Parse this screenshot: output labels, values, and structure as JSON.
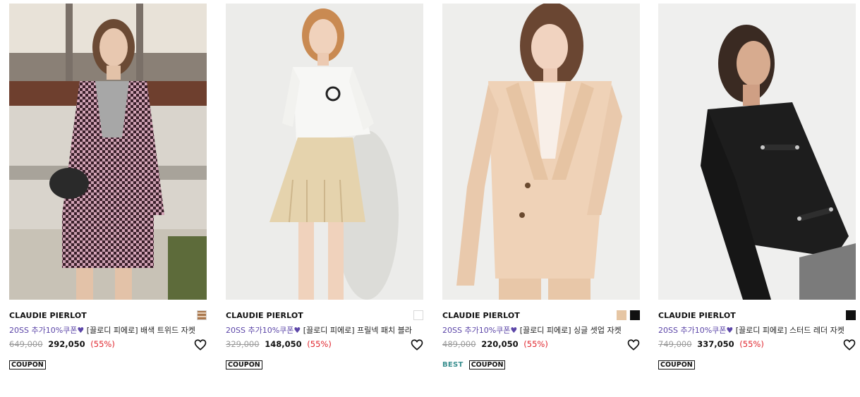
{
  "products": [
    {
      "brand": "CLAUDIE PIERLOT",
      "promo": "20SS 추가10%쿠폰",
      "heart": "♥",
      "name": "[끌로디 피에로] 배색 트위드 자켓",
      "original_price": "649,000",
      "sale_price": "292,050",
      "discount": "(55%)",
      "swatches": [
        "#a9784f"
      ],
      "best": "",
      "coupon": "COUPON",
      "image": "model in pink-black tweed jacket by a bridge"
    },
    {
      "brand": "CLAUDIE PIERLOT",
      "promo": "20SS 추가10%쿠폰",
      "heart": "♥",
      "name": "[끌로디 피에로] 프릴넥 패치 블라",
      "original_price": "329,000",
      "sale_price": "148,050",
      "discount": "(55%)",
      "swatches": [
        "#ffffff"
      ],
      "best": "",
      "coupon": "COUPON",
      "image": "model in white blouse and beige pleated skirt"
    },
    {
      "brand": "CLAUDIE PIERLOT",
      "promo": "20SS 추가10%쿠폰",
      "heart": "♥",
      "name": "[끌로디 피에로] 싱글 셋업 자켓",
      "original_price": "489,000",
      "sale_price": "220,050",
      "discount": "(55%)",
      "swatches": [
        "#e6c6a4",
        "#111111"
      ],
      "best": "BEST",
      "coupon": "COUPON",
      "image": "model in beige single-breasted blazer"
    },
    {
      "brand": "CLAUDIE PIERLOT",
      "promo": "20SS 추가10%쿠폰",
      "heart": "♥",
      "name": "[끌로디 피에로] 스터드 레더 자켓",
      "original_price": "749,000",
      "sale_price": "337,050",
      "discount": "(55%)",
      "swatches": [
        "#111111"
      ],
      "best": "",
      "coupon": "COUPON",
      "image": "model in black studded leather jacket"
    }
  ],
  "icons": {
    "like": "heart-outline-icon"
  },
  "colors": {
    "promo": "#5c46a8",
    "discount": "#e0262e",
    "best": "#3a8f8f"
  }
}
